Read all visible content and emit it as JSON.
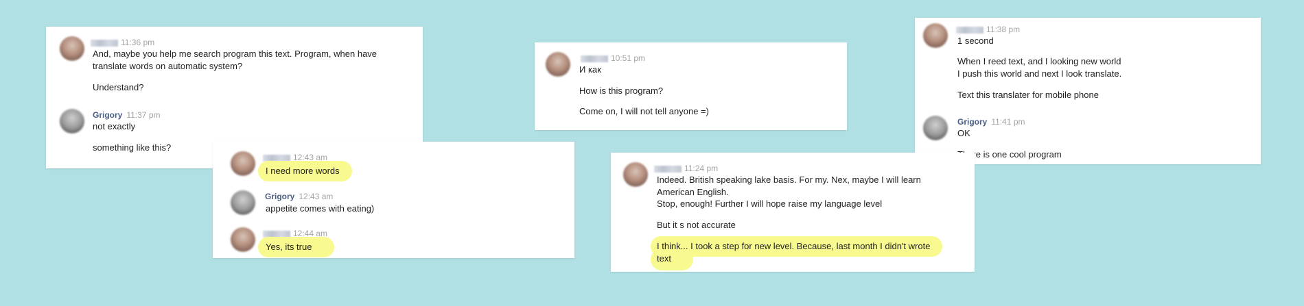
{
  "colors": {
    "background": "#b0e0e3",
    "highlight": "#f8f98e",
    "author": "#4a5f85",
    "time": "#a3a3a3"
  },
  "card1": {
    "m1": {
      "time": "11:36 pm",
      "lines": [
        "And, maybe you help me search program this text. Program, when have",
        "translate words on automatic system?",
        "Understand?"
      ]
    },
    "m2": {
      "author": "Grigory",
      "time": "11:37 pm",
      "lines": [
        "not exactly",
        "something like this?"
      ]
    }
  },
  "card2": {
    "m1": {
      "time": "12:43 am",
      "lines": [
        "I need more words"
      ]
    },
    "m2": {
      "author": "Grigory",
      "time": "12:43 am",
      "lines": [
        "appetite comes with eating)"
      ]
    },
    "m3": {
      "time": "12:44 am",
      "lines": [
        "Yes, its true"
      ]
    }
  },
  "card3": {
    "m1": {
      "time": "10:51 pm",
      "lines": [
        "И как",
        "How is this program?",
        "Come on, I will not tell anyone =)"
      ]
    }
  },
  "card4": {
    "m1": {
      "time": "11:24 pm",
      "lines": [
        "Indeed. British speaking lake basis. For my. Nex, maybe I will learn",
        "American English.",
        "Stop, enough! Further I will hope raise my language level",
        "But it s not accurate",
        "I think... I took a step for new level. Because, last month I didn't wrote",
        "text"
      ]
    }
  },
  "card5": {
    "m1": {
      "time": "11:38 pm",
      "lines": [
        "1 second",
        "When I reed text, and I looking new world",
        "I push this world and next I look translate.",
        "Text this translater for mobile phone"
      ]
    },
    "m2": {
      "author": "Grigory",
      "time": "11:41 pm",
      "lines": [
        "OK",
        "There is one cool program"
      ]
    }
  }
}
